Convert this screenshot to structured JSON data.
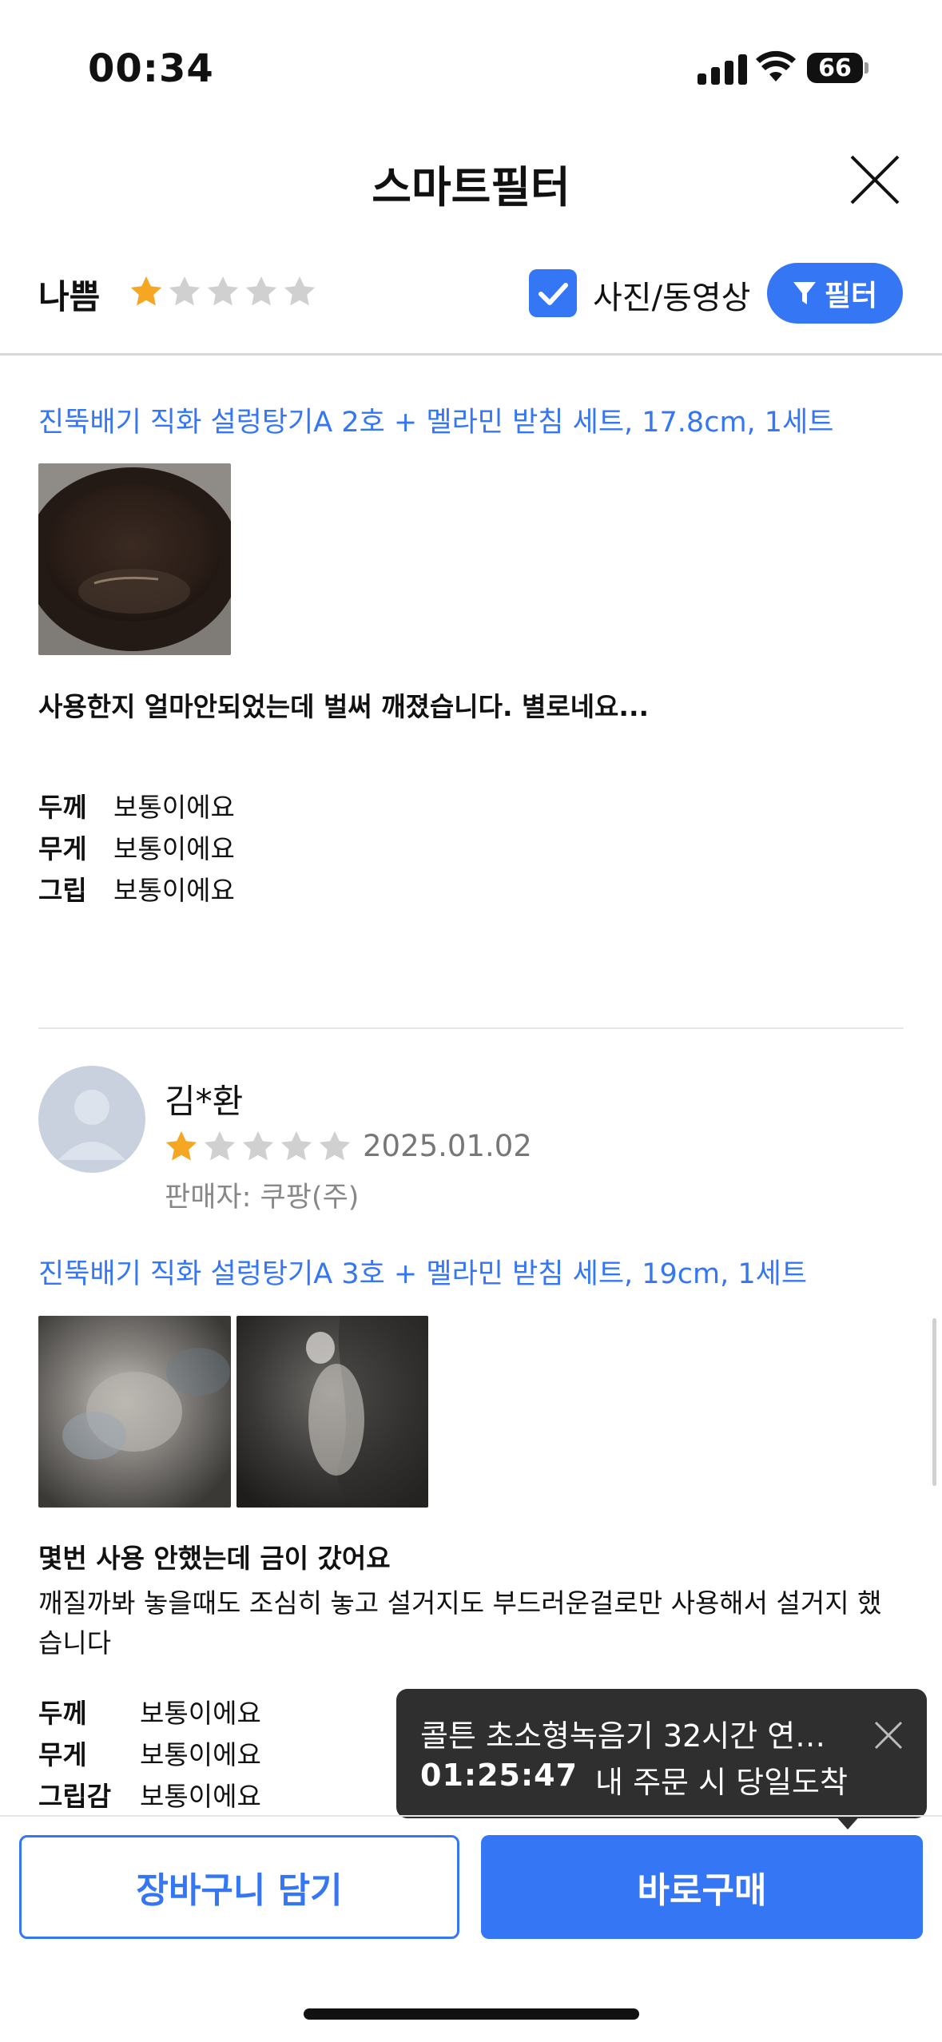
{
  "status_bar": {
    "time": "00:34",
    "battery": "66"
  },
  "header": {
    "title": "스마트필터"
  },
  "filter_bar": {
    "rating_label": "나쁨",
    "rating_stars": 1,
    "photo_video_label": "사진/동영상",
    "photo_video_checked": true,
    "filter_button_label": "필터"
  },
  "reviews": [
    {
      "product": "진뚝배기 직화 설렁탕기A 2호 + 멜라민 받침 세트, 17.8cm, 1세트",
      "title": "사용한지 얼마안되었는데 벌써 깨졌습니다. 별로네요...",
      "attributes": [
        {
          "key": "두께",
          "value": "보통이에요"
        },
        {
          "key": "무게",
          "value": "보통이에요"
        },
        {
          "key": "그립",
          "value": "보통이에요"
        }
      ]
    },
    {
      "reviewer": "김*환",
      "stars": 1,
      "date": "2025.01.02",
      "seller": "판매자: 쿠팡(주)",
      "product": "진뚝배기 직화 설렁탕기A 3호 + 멜라민 받침 세트, 19cm, 1세트",
      "title": "몇번 사용 안했는데 금이 갔어요",
      "body_line1": "깨질까봐 놓을때도 조심히 놓고 설거지도 부드러운걸로만 사용해서 설거지 했",
      "body_line2": "습니다",
      "attributes": [
        {
          "key": "두께",
          "value": "보통이에요"
        },
        {
          "key": "무게",
          "value": "보통이에요"
        },
        {
          "key": "그립감",
          "value": "보통이에요"
        }
      ]
    }
  ],
  "toast": {
    "product": "콜튼 초소형녹음기 32시간 연…",
    "countdown": "01:25:47",
    "message": "내 주문 시 당일도착"
  },
  "actions": {
    "cart_label": "장바구니 담기",
    "buy_label": "바로구매"
  },
  "colors": {
    "accent": "#3576f5",
    "star_active": "#f5a623",
    "star_inactive": "#d0d0d0"
  }
}
